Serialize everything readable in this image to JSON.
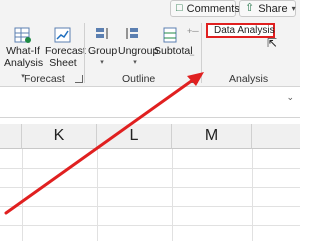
{
  "top_bar": {
    "comments_label": "Comments",
    "share_label": "Share"
  },
  "ribbon": {
    "groups": {
      "forecast": "Forecast",
      "outline": "Outline",
      "analysis": "Analysis"
    },
    "buttons": {
      "what_if_line1": "What-If",
      "what_if_line2": "Analysis",
      "forecast_line1": "Forecast",
      "forecast_line2": "Sheet",
      "group": "Group",
      "ungroup": "Ungroup",
      "subtotal": "Subtotal",
      "data_analysis": "Data Analysis"
    }
  },
  "grid": {
    "columns": [
      "K",
      "L",
      "M"
    ]
  },
  "colors": {
    "accent_green": "#217346",
    "highlight_red": "#e02020",
    "ribbon_bg": "#f3f3f3"
  }
}
